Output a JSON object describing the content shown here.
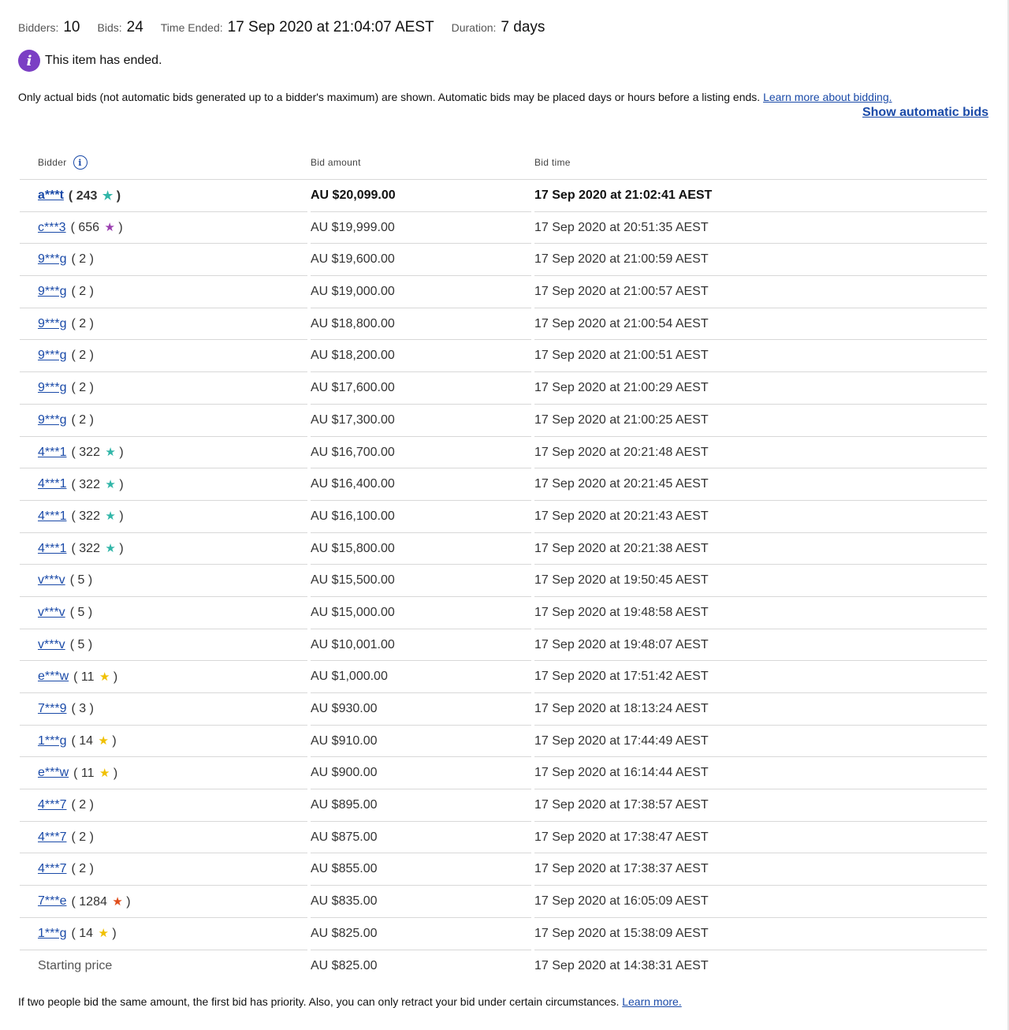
{
  "summary": {
    "bidders_label": "Bidders:",
    "bidders_value": "10",
    "bids_label": "Bids:",
    "bids_value": "24",
    "time_label": "Time Ended:",
    "time_value": "17 Sep 2020 at 21:04:07 AEST",
    "duration_label": "Duration:",
    "duration_value": "7 days"
  },
  "status": {
    "icon": "info-icon",
    "text": "This item has ended.",
    "icon_color": "#7b3fc4"
  },
  "note": {
    "text": "Only actual bids (not automatic bids generated up to a bidder's maximum) are shown. Automatic bids may be placed days or hours before a listing ends.",
    "link": "Learn more about bidding."
  },
  "show_automatic_bids": "Show automatic bids",
  "table": {
    "headers": {
      "bidder": "Bidder",
      "amount": "Bid amount",
      "time": "Bid time"
    },
    "rows": [
      {
        "bidder": "a***t",
        "feedback": "243",
        "star": "teal",
        "amount": "AU $20,099.00",
        "time": "17 Sep 2020 at 21:02:41 AEST"
      },
      {
        "bidder": "c***3",
        "feedback": "656",
        "star": "purple",
        "amount": "AU $19,999.00",
        "time": "17 Sep 2020 at 20:51:35 AEST"
      },
      {
        "bidder": "9***g",
        "feedback": "2",
        "star": "",
        "amount": "AU $19,600.00",
        "time": "17 Sep 2020 at 21:00:59 AEST"
      },
      {
        "bidder": "9***g",
        "feedback": "2",
        "star": "",
        "amount": "AU $19,000.00",
        "time": "17 Sep 2020 at 21:00:57 AEST"
      },
      {
        "bidder": "9***g",
        "feedback": "2",
        "star": "",
        "amount": "AU $18,800.00",
        "time": "17 Sep 2020 at 21:00:54 AEST"
      },
      {
        "bidder": "9***g",
        "feedback": "2",
        "star": "",
        "amount": "AU $18,200.00",
        "time": "17 Sep 2020 at 21:00:51 AEST"
      },
      {
        "bidder": "9***g",
        "feedback": "2",
        "star": "",
        "amount": "AU $17,600.00",
        "time": "17 Sep 2020 at 21:00:29 AEST"
      },
      {
        "bidder": "9***g",
        "feedback": "2",
        "star": "",
        "amount": "AU $17,300.00",
        "time": "17 Sep 2020 at 21:00:25 AEST"
      },
      {
        "bidder": "4***1",
        "feedback": "322",
        "star": "teal",
        "amount": "AU $16,700.00",
        "time": "17 Sep 2020 at 20:21:48 AEST"
      },
      {
        "bidder": "4***1",
        "feedback": "322",
        "star": "teal",
        "amount": "AU $16,400.00",
        "time": "17 Sep 2020 at 20:21:45 AEST"
      },
      {
        "bidder": "4***1",
        "feedback": "322",
        "star": "teal",
        "amount": "AU $16,100.00",
        "time": "17 Sep 2020 at 20:21:43 AEST"
      },
      {
        "bidder": "4***1",
        "feedback": "322",
        "star": "teal",
        "amount": "AU $15,800.00",
        "time": "17 Sep 2020 at 20:21:38 AEST"
      },
      {
        "bidder": "v***v",
        "feedback": "5",
        "star": "",
        "amount": "AU $15,500.00",
        "time": "17 Sep 2020 at 19:50:45 AEST"
      },
      {
        "bidder": "v***v",
        "feedback": "5",
        "star": "",
        "amount": "AU $15,000.00",
        "time": "17 Sep 2020 at 19:48:58 AEST"
      },
      {
        "bidder": "v***v",
        "feedback": "5",
        "star": "",
        "amount": "AU $10,001.00",
        "time": "17 Sep 2020 at 19:48:07 AEST"
      },
      {
        "bidder": "e***w",
        "feedback": "11",
        "star": "yellow",
        "amount": "AU $1,000.00",
        "time": "17 Sep 2020 at 17:51:42 AEST"
      },
      {
        "bidder": "7***9",
        "feedback": "3",
        "star": "",
        "amount": "AU $930.00",
        "time": "17 Sep 2020 at 18:13:24 AEST"
      },
      {
        "bidder": "1***g",
        "feedback": "14",
        "star": "yellow",
        "amount": "AU $910.00",
        "time": "17 Sep 2020 at 17:44:49 AEST"
      },
      {
        "bidder": "e***w",
        "feedback": "11",
        "star": "yellow",
        "amount": "AU $900.00",
        "time": "17 Sep 2020 at 16:14:44 AEST"
      },
      {
        "bidder": "4***7",
        "feedback": "2",
        "star": "",
        "amount": "AU $895.00",
        "time": "17 Sep 2020 at 17:38:57 AEST"
      },
      {
        "bidder": "4***7",
        "feedback": "2",
        "star": "",
        "amount": "AU $875.00",
        "time": "17 Sep 2020 at 17:38:47 AEST"
      },
      {
        "bidder": "4***7",
        "feedback": "2",
        "star": "",
        "amount": "AU $855.00",
        "time": "17 Sep 2020 at 17:38:37 AEST"
      },
      {
        "bidder": "7***e",
        "feedback": "1284",
        "star": "red",
        "amount": "AU $835.00",
        "time": "17 Sep 2020 at 16:05:09 AEST"
      },
      {
        "bidder": "1***g",
        "feedback": "14",
        "star": "yellow",
        "amount": "AU $825.00",
        "time": "17 Sep 2020 at 15:38:09 AEST"
      }
    ],
    "starting": {
      "label": "Starting price",
      "amount": "AU $825.00",
      "time": "17 Sep 2020 at 14:38:31 AEST"
    }
  },
  "footer": {
    "text": "If two people bid the same amount, the first bid has priority. Also, you can only retract your bid under certain circumstances.",
    "link": "Learn more."
  }
}
